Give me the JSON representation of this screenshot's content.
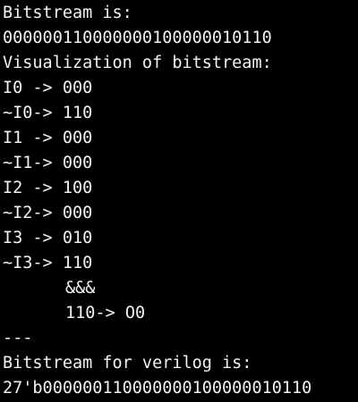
{
  "terminal": {
    "header_label": "Bitstream is:",
    "bitstream": "000000110000000100000010110",
    "visualization_label": "Visualization of bitstream:",
    "mapping": [
      {
        "input": "I0 -> ",
        "bits": "000"
      },
      {
        "input": "~I0-> ",
        "bits": "110"
      },
      {
        "input": "I1 -> ",
        "bits": "000"
      },
      {
        "input": "~I1-> ",
        "bits": "000"
      },
      {
        "input": "I2 -> ",
        "bits": "100"
      },
      {
        "input": "~I2-> ",
        "bits": "000"
      },
      {
        "input": "I3 -> ",
        "bits": "010"
      },
      {
        "input": "~I3-> ",
        "bits": "110"
      }
    ],
    "and_operator": "&&&",
    "output_line": "110-> O0",
    "separator": "---",
    "verilog_label": "Bitstream for verilog is:",
    "verilog_bitstream": "27'b000000110000000100000010110"
  },
  "colors": {
    "background": "#000000",
    "text": "#f2f2f2"
  }
}
